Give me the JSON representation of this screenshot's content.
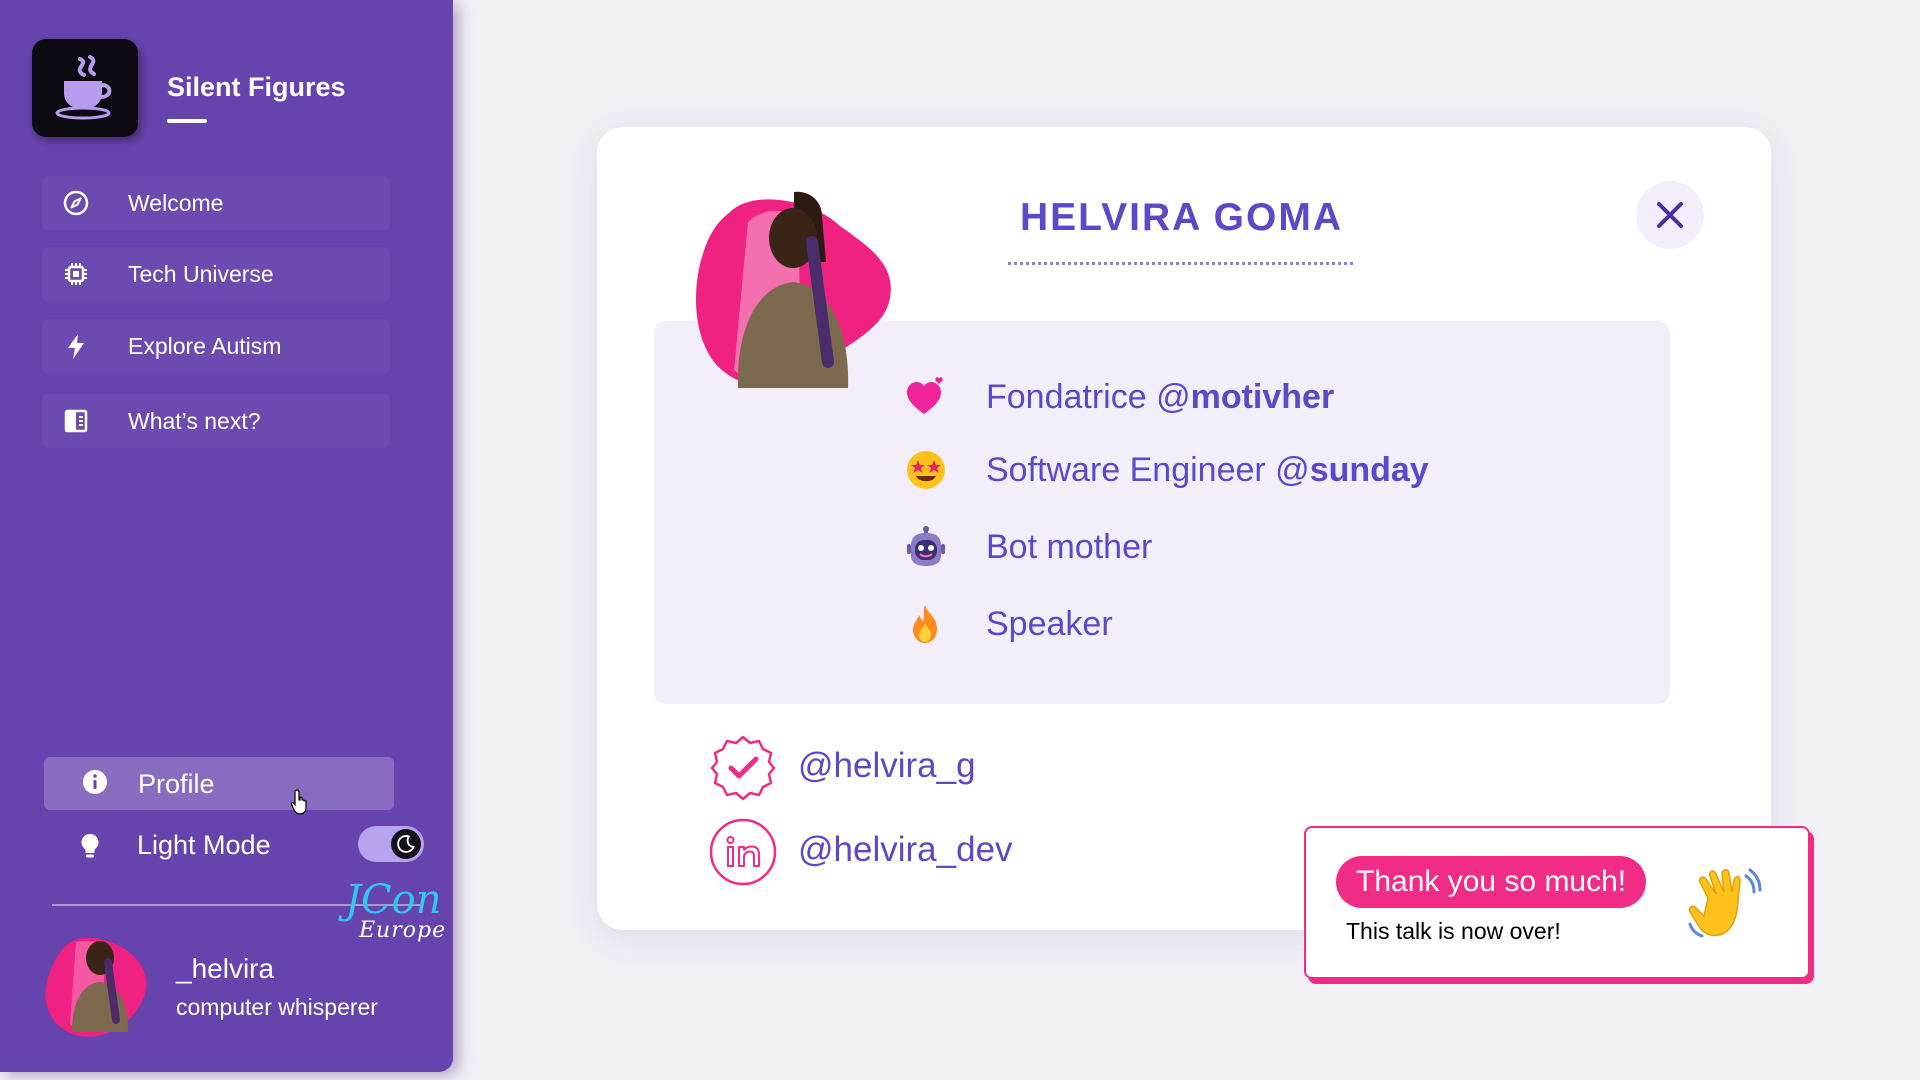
{
  "app": {
    "brand": "Silent Figures",
    "logo_icon": "teacup-icon"
  },
  "sidebar": {
    "items": [
      {
        "label": "Welcome",
        "icon": "compass-icon"
      },
      {
        "label": "Tech Universe",
        "icon": "chip-icon"
      },
      {
        "label": "Explore Autism",
        "icon": "bolt-icon"
      },
      {
        "label": "What’s next?",
        "icon": "panels-icon"
      }
    ],
    "profile": {
      "label": "Profile",
      "icon": "info-icon",
      "active": true
    },
    "light_mode": {
      "label": "Light Mode",
      "icon": "bulb-icon",
      "dark_enabled": true
    },
    "event_logo": "jcon-europe-logo",
    "user": {
      "name": "_helvira",
      "role": "computer whisperer"
    }
  },
  "card": {
    "name": "HELVIRA GOMA",
    "close_icon": "close-icon",
    "roles": [
      {
        "emoji": "heart-emoji",
        "prefix": "Fondatrice @",
        "handle": "motivher"
      },
      {
        "emoji": "star-struck-emoji",
        "prefix": "Software Engineer @",
        "handle": "sunday"
      },
      {
        "emoji": "robot-emoji",
        "prefix": "Bot mother",
        "handle": ""
      },
      {
        "emoji": "fire-emoji",
        "prefix": "Speaker",
        "handle": ""
      }
    ],
    "socials": [
      {
        "icon": "verified-badge-icon",
        "handle": "@helvira_g"
      },
      {
        "icon": "linkedin-icon",
        "handle": "@helvira_dev"
      }
    ]
  },
  "toast": {
    "title": "Thank you so much!",
    "message": "This talk is now over!",
    "icon": "waving-hand-emoji"
  },
  "colors": {
    "sidebar": "#6743ad",
    "accent": "#5a49c8",
    "pink": "#f02c86",
    "background": "#f1f0f5"
  }
}
